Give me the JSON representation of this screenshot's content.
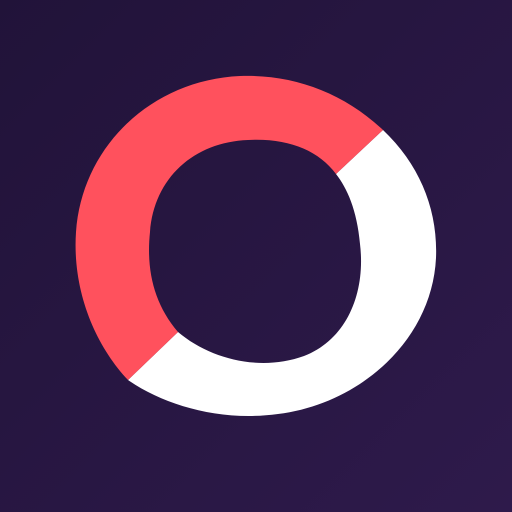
{
  "app_icon": {
    "icon": "ring-logo-icon",
    "colors": {
      "background_top": "#211339",
      "background_bottom": "#2e1a4b",
      "ring_coral": "#ff515d",
      "ring_white": "#ffffff"
    }
  }
}
